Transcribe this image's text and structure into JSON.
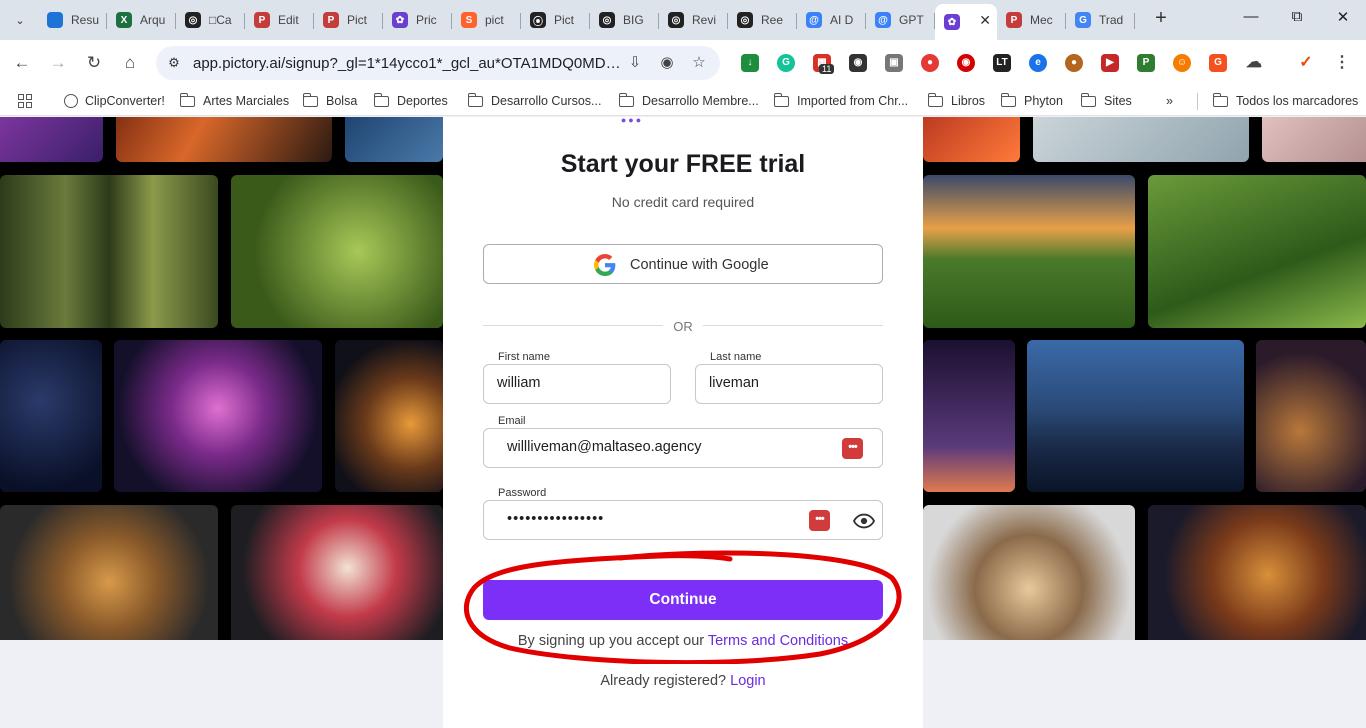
{
  "browser": {
    "tabs": [
      {
        "label": "Resu",
        "icon": "onedrive-icon",
        "color": "#1e73d6",
        "glyph": ""
      },
      {
        "label": "Arqu",
        "icon": "excel-icon",
        "color": "#1d6f42",
        "glyph": "X"
      },
      {
        "label": "□Ca",
        "icon": "openai-icon",
        "color": "#222222",
        "glyph": "◎"
      },
      {
        "label": "Edit",
        "icon": "pictory-icon",
        "color": "#c43d3d",
        "glyph": "P"
      },
      {
        "label": "Pict",
        "icon": "pictory-icon",
        "color": "#c43d3d",
        "glyph": "P"
      },
      {
        "label": "Pric",
        "icon": "octopus-icon",
        "color": "#6a3fd1",
        "glyph": "✿"
      },
      {
        "label": "pict",
        "icon": "semrush-icon",
        "color": "#ff622d",
        "glyph": "S"
      },
      {
        "label": "Pict",
        "icon": "podcast-icon",
        "color": "#222222",
        "glyph": "⦿"
      },
      {
        "label": "BIG",
        "icon": "openai-icon",
        "color": "#222222",
        "glyph": "◎"
      },
      {
        "label": "Revi",
        "icon": "openai-icon",
        "color": "#222222",
        "glyph": "◎"
      },
      {
        "label": "Ree",
        "icon": "openai-icon",
        "color": "#222222",
        "glyph": "◎"
      },
      {
        "label": "AI D",
        "icon": "gpt-spiral-icon",
        "color": "#3b82f6",
        "glyph": "@"
      },
      {
        "label": "GPT",
        "icon": "gpt-spiral-icon",
        "color": "#3b82f6",
        "glyph": "@"
      },
      {
        "label": "",
        "icon": "octopus-icon",
        "color": "#6a3fd1",
        "glyph": "✿",
        "active": true
      },
      {
        "label": "Mec",
        "icon": "pictory-icon",
        "color": "#c43d3d",
        "glyph": "P"
      },
      {
        "label": "Trad",
        "icon": "translate-icon",
        "color": "#4285f4",
        "glyph": "G"
      }
    ],
    "url": "app.pictory.ai/signup?_gl=1*14ycco1*_gcl_au*OTA1MDQ0MDAyLjE...",
    "extension_badge": "11",
    "bookmarks": [
      {
        "label": "ClipConverter!",
        "icon": "globe-icon"
      },
      {
        "label": "Artes Marciales",
        "icon": "folder-icon"
      },
      {
        "label": "Bolsa",
        "icon": "folder-icon"
      },
      {
        "label": "Deportes",
        "icon": "folder-icon"
      },
      {
        "label": "Desarrollo Cursos...",
        "icon": "folder-icon"
      },
      {
        "label": "Desarrollo Membre...",
        "icon": "folder-icon"
      },
      {
        "label": "Imported from Chr...",
        "icon": "folder-icon"
      },
      {
        "label": "Libros",
        "icon": "folder-icon"
      },
      {
        "label": "Phyton",
        "icon": "folder-icon"
      },
      {
        "label": "Sites",
        "icon": "folder-icon"
      }
    ],
    "bookmarks_overflow": "»",
    "all_bookmarks": "Todos los marcadores"
  },
  "signup": {
    "title": "Start your FREE trial",
    "subtitle": "No credit card required",
    "google_button": "Continue with Google",
    "divider": "OR",
    "first_name": {
      "label": "First name",
      "value": "william"
    },
    "last_name": {
      "label": "Last name",
      "value": "liveman"
    },
    "email": {
      "label": "Email",
      "value": "willliveman@maltaseo.agency"
    },
    "password": {
      "label": "Password",
      "value": "••••••••••••••••"
    },
    "continue_button": "Continue",
    "terms_prefix": "By signing up you accept our ",
    "terms_link": "Terms and Conditions",
    "login_prefix": "Already registered? ",
    "login_link": "Login"
  },
  "colors": {
    "accent": "#7b2ff7",
    "link": "#6a2ce0",
    "annotation": "#e00000",
    "password_manager": "#d23b3b"
  }
}
